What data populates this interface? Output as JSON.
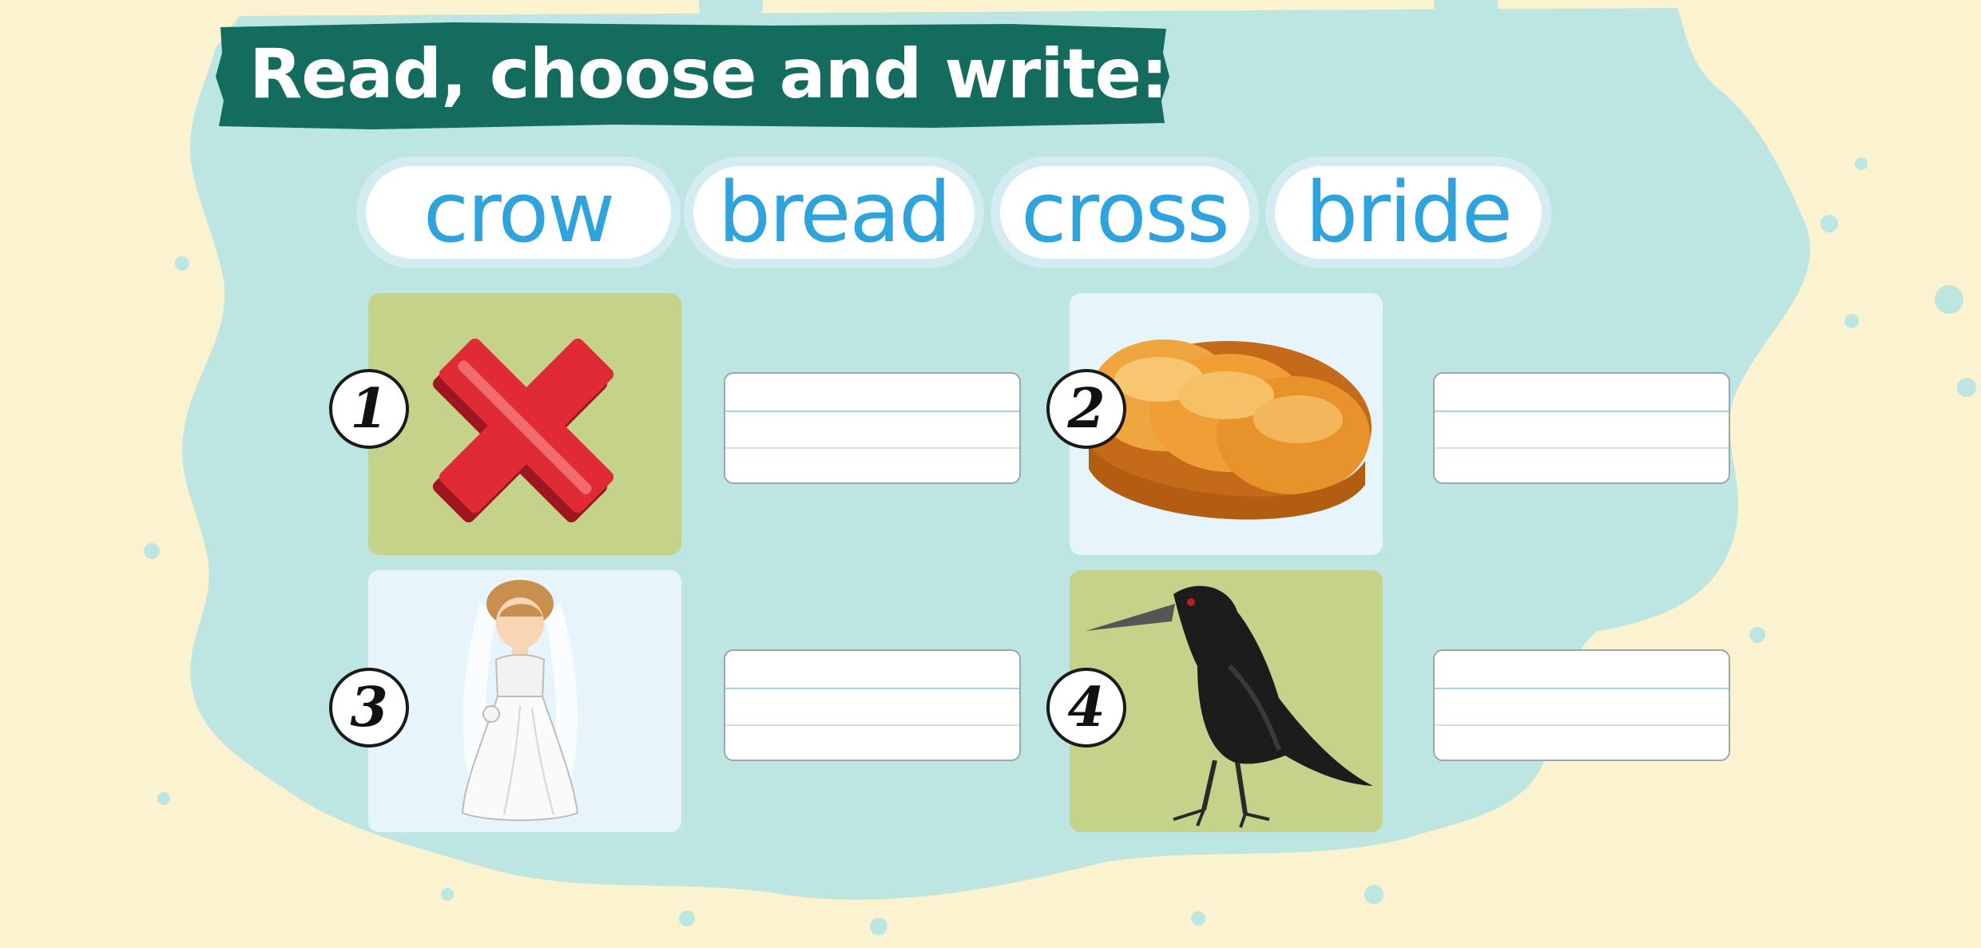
{
  "worksheet": {
    "title": "Read, choose and write:",
    "word_bank": [
      "crow",
      "bread",
      "cross",
      "bride"
    ],
    "items": [
      {
        "number": "1",
        "picture": "red-cross-x",
        "answer": ""
      },
      {
        "number": "2",
        "picture": "bread-loaf",
        "answer": ""
      },
      {
        "number": "3",
        "picture": "bride",
        "answer": ""
      },
      {
        "number": "4",
        "picture": "crow",
        "answer": ""
      }
    ]
  },
  "colors": {
    "page_background": "#fbf2cf",
    "splash": "#bde5e1",
    "title_banner": "#146c5f",
    "word_text": "#2ea3dc",
    "card_green": "#c5d38a",
    "card_blue": "#e7f4fc"
  }
}
